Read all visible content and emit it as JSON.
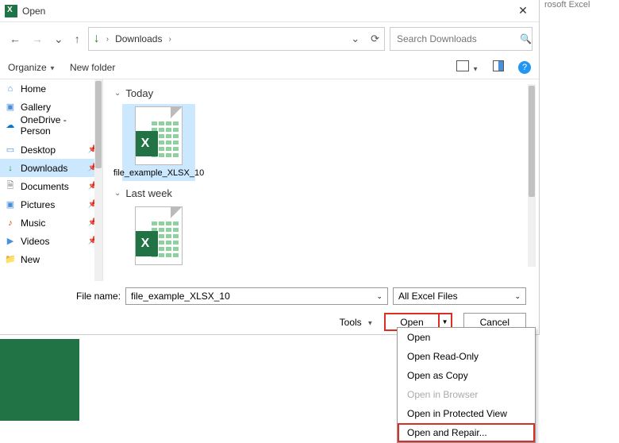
{
  "bg_app": "rosoft Excel",
  "dialog": {
    "title": "Open",
    "close_glyph": "✕"
  },
  "nav": {
    "back": "←",
    "fwd": "→",
    "recent": "⌄",
    "up": "↑",
    "dl_icon": "↓",
    "breadcrumb": "Downloads",
    "chev": "›",
    "hist_glyph": "⌄",
    "refresh_glyph": "⟳"
  },
  "search": {
    "placeholder": "Search Downloads",
    "icon": "🔍"
  },
  "toolbar": {
    "organize": "Organize",
    "newfolder": "New folder",
    "help": "?"
  },
  "sidebar": {
    "items": [
      {
        "icon": "⌂",
        "cls": "ico-home",
        "label": "Home"
      },
      {
        "icon": "▣",
        "cls": "ico-gallery",
        "label": "Gallery"
      },
      {
        "icon": "☁",
        "cls": "ico-cloud",
        "label": "OneDrive - Person"
      }
    ],
    "items2": [
      {
        "icon": "▭",
        "cls": "ico-desktop",
        "label": "Desktop",
        "pin": true
      },
      {
        "icon": "↓",
        "cls": "ico-download",
        "label": "Downloads",
        "pin": true,
        "selected": true
      },
      {
        "icon": "🗎",
        "cls": "ico-doc",
        "label": "Documents",
        "pin": true
      },
      {
        "icon": "▣",
        "cls": "ico-pic",
        "label": "Pictures",
        "pin": true
      },
      {
        "icon": "♪",
        "cls": "ico-music",
        "label": "Music",
        "pin": true
      },
      {
        "icon": "▶",
        "cls": "ico-video",
        "label": "Videos",
        "pin": true
      },
      {
        "icon": "📁",
        "cls": "ico-new",
        "label": "New"
      }
    ]
  },
  "main": {
    "groups": [
      {
        "label": "Today",
        "files": [
          {
            "name": "file_example_XLSX_10",
            "selected": true
          }
        ]
      },
      {
        "label": "Last week",
        "files": [
          {
            "name": ""
          }
        ]
      }
    ]
  },
  "footer": {
    "file_label": "File name:",
    "file_value": "file_example_XLSX_10",
    "filter": "All Excel Files",
    "tools": "Tools",
    "open": "Open",
    "cancel": "Cancel",
    "split_glyph": "▼"
  },
  "menu": {
    "items": [
      {
        "label": "Open"
      },
      {
        "label": "Open Read-Only"
      },
      {
        "label": "Open as Copy"
      },
      {
        "label": "Open in Browser",
        "disabled": true
      },
      {
        "label": "Open in Protected View"
      },
      {
        "label": "Open and Repair...",
        "highlight": true
      }
    ]
  }
}
